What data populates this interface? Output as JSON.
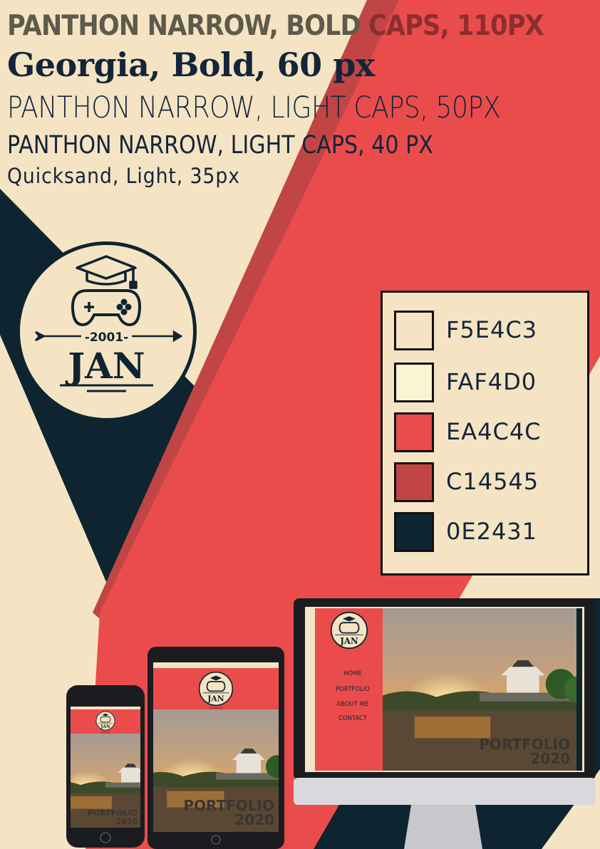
{
  "typography": {
    "line1_part1": "PANTHON NARROW, BOLD ",
    "line1_part2": "CAPS, 110PX",
    "line2": "Georgia, Bold, 60 px",
    "line3": "PANTHON NARROW, LIGHT CAPS, 50PX",
    "line4": "PANTHON NARROW, LIGHT CAPS, 40 PX",
    "line5": "Quicksand, Light, 35px"
  },
  "logo": {
    "year": "-2001-",
    "name": "JAN",
    "icons": [
      "graduation-cap-icon",
      "gamepad-icon",
      "arrow-icon"
    ]
  },
  "palette": [
    {
      "hex": "#F5E4C3",
      "label": "F5E4C3"
    },
    {
      "hex": "#FAF4D0",
      "label": "FAF4D0"
    },
    {
      "hex": "#EA4C4C",
      "label": "EA4C4C"
    },
    {
      "hex": "#C14545",
      "label": "C14545"
    },
    {
      "hex": "#0E2431",
      "label": "0E2431"
    }
  ],
  "mockups": {
    "nav": [
      "HOME",
      "PORTFOLIO",
      "ABOUT ME",
      "CONTACT"
    ],
    "portfolio_title": "PORTFOLIO",
    "portfolio_year": "2020",
    "logo_year": "-2001-",
    "logo_name": "JAN"
  },
  "colors": {
    "cream": "#F5E4C3",
    "light": "#FAF4D0",
    "red": "#EA4C4C",
    "dark_red": "#C14545",
    "navy": "#0E2431"
  }
}
